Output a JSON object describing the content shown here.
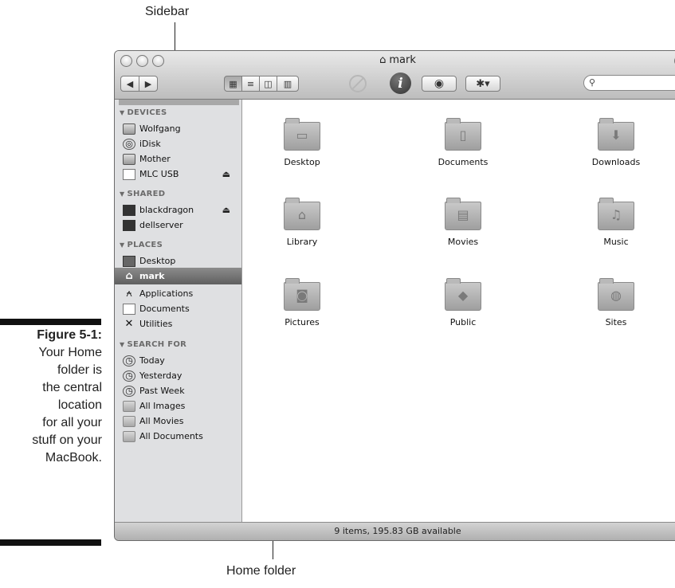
{
  "callouts": {
    "sidebar": "Sidebar",
    "home_folder": "Home folder"
  },
  "caption": {
    "figure": "Figure 5-1:",
    "text_lines": [
      "Your Home",
      "folder is",
      "the central",
      "location",
      "for all your",
      "stuff on your",
      "MacBook."
    ]
  },
  "window": {
    "title": "mark",
    "search_placeholder": "",
    "status": "9 items, 195.83 GB available"
  },
  "sidebar": {
    "devices": {
      "header": "DEVICES",
      "items": [
        "Wolfgang",
        "iDisk",
        "Mother",
        "MLC USB"
      ]
    },
    "shared": {
      "header": "SHARED",
      "items": [
        "blackdragon",
        "dellserver"
      ]
    },
    "places": {
      "header": "PLACES",
      "items": [
        "Desktop",
        "mark",
        "Applications",
        "Documents",
        "Utilities"
      ]
    },
    "search_for": {
      "header": "SEARCH FOR",
      "items": [
        "Today",
        "Yesterday",
        "Past Week",
        "All Images",
        "All Movies",
        "All Documents"
      ]
    }
  },
  "folders": [
    "Desktop",
    "Documents",
    "Downloads",
    "Library",
    "Movies",
    "Music",
    "Pictures",
    "Public",
    "Sites"
  ]
}
